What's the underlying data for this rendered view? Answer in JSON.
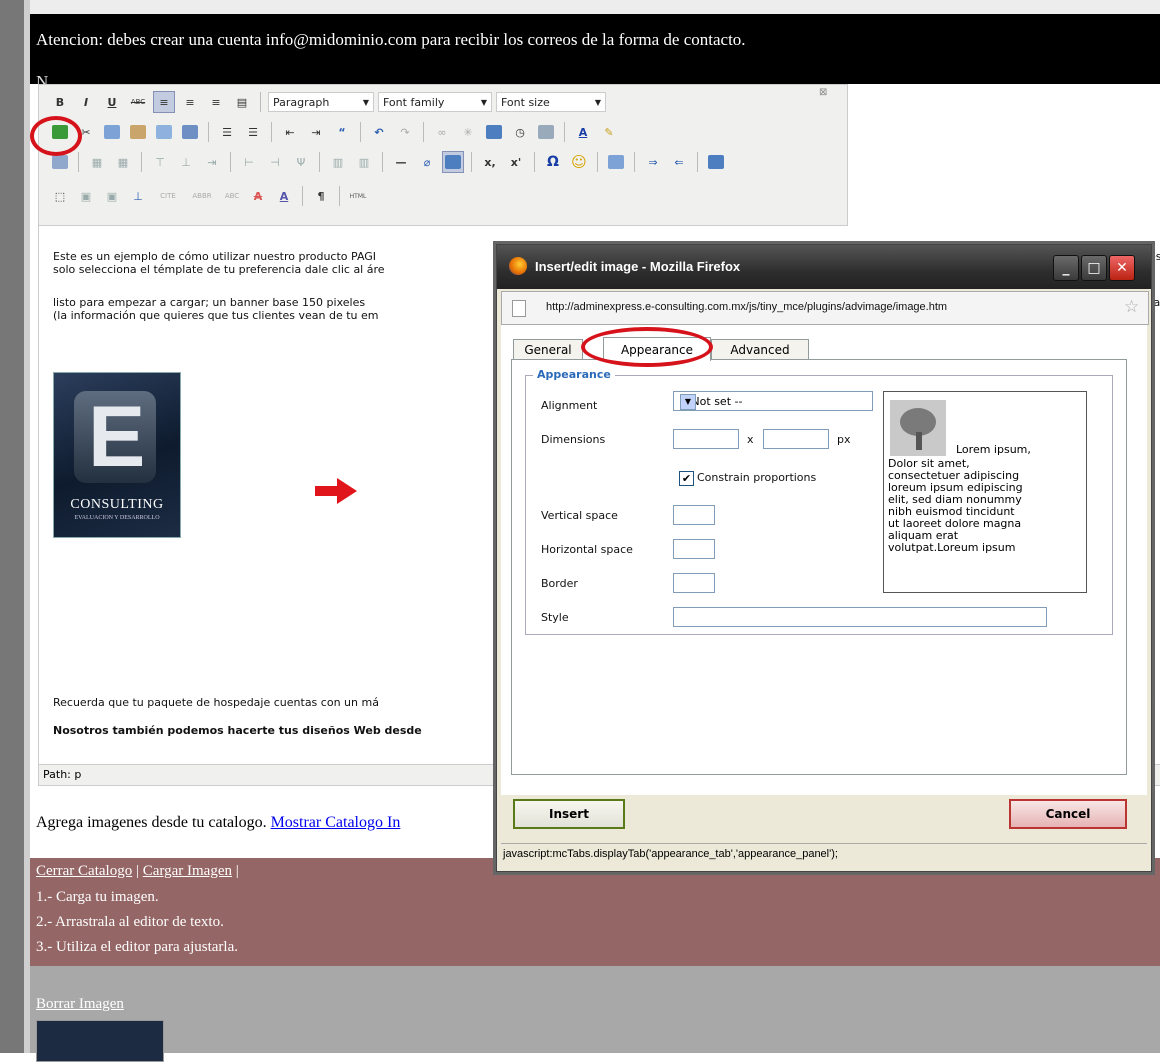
{
  "page": {
    "notice": "Atencion: debes crear una cuenta info@midominio.com para recibir los correos de la forma de contacto.",
    "notice2": "N"
  },
  "toolbar": {
    "format_select": "Paragraph",
    "font_family_select": "Font family",
    "font_size_select": "Font size",
    "bold": "B",
    "italic": "I",
    "underline": "U",
    "strike": "ABC",
    "subscript": "x,",
    "superscript": "x'",
    "omega": "Ω",
    "pilcrow": "¶",
    "html": "HTML"
  },
  "editor": {
    "p1_line1": "Este es un ejemplo de cómo utilizar nuestro producto PAGI",
    "p1_line2": "solo selecciona el témplate de tu preferencia dale clic al áre",
    "p2_line1": "listo para empezar  a  cargar;  un banner base 150 pixeles",
    "p2_line2": "(la información que quieres que tus clientes vean de tu em",
    "p3": "Recuerda que tu paquete de hospedaje cuentas con un má",
    "p4": "Nosotros también podemos hacerte tus diseños Web desde",
    "right_frag1": "es",
    "right_frag2": "ra",
    "right_frag3": "y",
    "logo_text": "CONSULTING",
    "logo_sub": "EVALUACION Y DESARROLLO",
    "path": "Path: p"
  },
  "catalog": {
    "intro": "Agrega imagenes desde tu catalogo.",
    "show_link": "Mostrar Catalogo In",
    "close_link": "Cerrar Catalogo",
    "upload_link": "Cargar Imagen",
    "sep": "|",
    "step1": "1.- Carga tu imagen.",
    "step2": "2.- Arrastrala al editor de texto.",
    "step3": "3.- Utiliza el editor para ajustarla.",
    "delete_link": "Borrar Imagen"
  },
  "dialog": {
    "title": "Insert/edit image - Mozilla Firefox",
    "url": "http://adminexpress.e-consulting.com.mx/js/tiny_mce/plugins/advimage/image.htm",
    "tabs": [
      "General",
      "Appearance",
      "Advanced"
    ],
    "legend": "Appearance",
    "alignment_label": "Alignment",
    "alignment_value": "-- Not set --",
    "dimensions_label": "Dimensions",
    "dim_x": "x",
    "dim_unit": "px",
    "constrain_label": "Constrain proportions",
    "vspace_label": "Vertical space",
    "hspace_label": "Horizontal space",
    "border_label": "Border",
    "style_label": "Style",
    "preview_p1": "Lorem ipsum,",
    "preview_p2": "Dolor sit amet,\nconsectetuer adipiscing\nloreum ipsum edipiscing\nelit, sed diam nonummy\nnibh euismod tincidunt\nut laoreet dolore magna\naliquam erat\nvolutpat.Loreum ipsum",
    "insert_label": "Insert",
    "cancel_label": "Cancel",
    "status": "javascript:mcTabs.displayTab('appearance_tab','appearance_panel');"
  },
  "colors": {
    "highlight_circle": "#d6121a",
    "catalog_band": "#956666",
    "legend": "#2b6ab8"
  }
}
